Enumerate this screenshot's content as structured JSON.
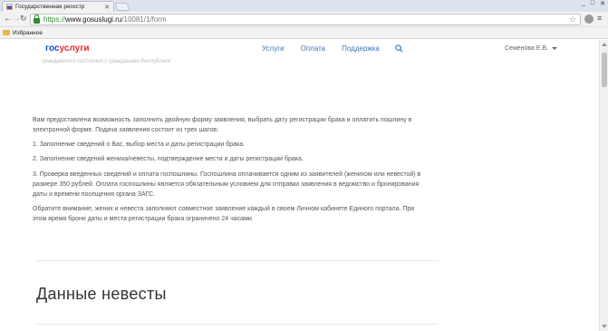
{
  "browser": {
    "tab_title": "Государственная регистр",
    "tab_close": "✕",
    "url_scheme": "https://",
    "url_host": "www.gosuslugi.ru",
    "url_path": "/10081/1/form",
    "bookmarks_folder": "Избранное",
    "window_controls": [
      "_",
      "□",
      "✕"
    ]
  },
  "header": {
    "logo_part1": "гос",
    "logo_part2": "услуги",
    "nav": [
      "Услуги",
      "Оплата",
      "Поддержка"
    ],
    "user_name": "Семенова Е.В."
  },
  "content": {
    "cut_text": "гражданского состояния с гражданами Республики",
    "intro": "Вам предоставлена возможность заполнить двойную форму заявления, выбрать дату регистрации брака и оплатить пошлину в электронной форме. Подача заявления состоит из трех шагов:",
    "step1": "1. Заполнение сведений о Вас, выбор места и даты регистрации брака.",
    "step2": "2. Заполнение сведений жениха/невесты, подтверждение места и даты регистрации брака.",
    "step3": "3. Проверка введенных сведений и оплата госпошлины. Госпошлина оплачивается одним из заявителей (женихом или невестой) в размере 350 рублей. Оплата госпошлины является обязательным условием для отправки заявления в ведомство и бронирования даты и времени посещения органа ЗАГС.",
    "note": "Обратите внимание, жених и невеста заполняют совместное заявление каждый в своем Личном кабинете Единого портала. При этом время брони даты и места регистрации брака ограничено 24 часами.",
    "section_title": "Данные невесты"
  },
  "colors": {
    "logo_blue": "#0d4cd3",
    "logo_red": "#e62c2c",
    "nav_link": "#3a7ab8"
  }
}
